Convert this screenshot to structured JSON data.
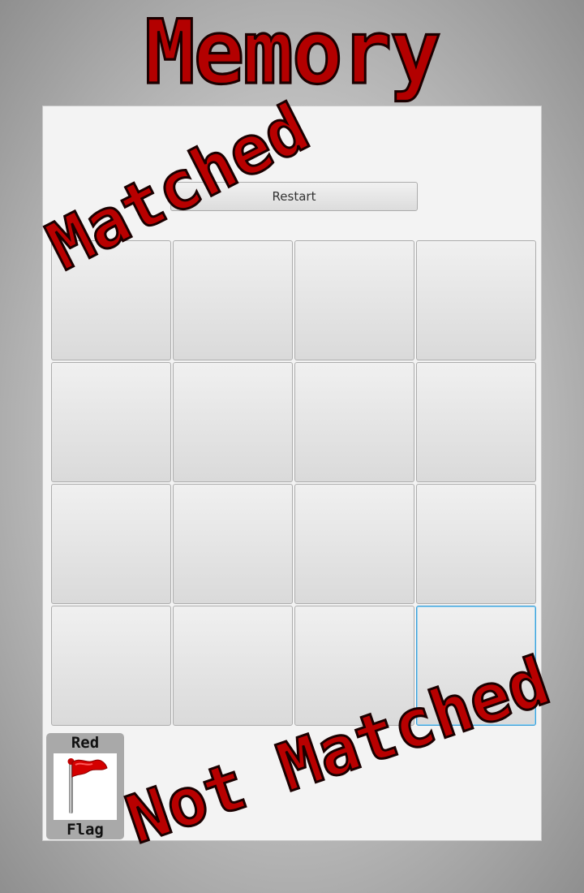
{
  "title": "Memory",
  "restart_label": "Restart",
  "board": {
    "rows": 4,
    "cols": 4,
    "focused_tile": 15
  },
  "legend": {
    "top_label": "Red",
    "bottom_label": "Flag",
    "icon": "red-flag-icon"
  },
  "stamps": {
    "matched": "Matched",
    "not_matched": "Not Matched"
  },
  "colors": {
    "title_red": "#b30000",
    "focus_blue": "#3c9fd8",
    "flag_red": "#d40000"
  }
}
